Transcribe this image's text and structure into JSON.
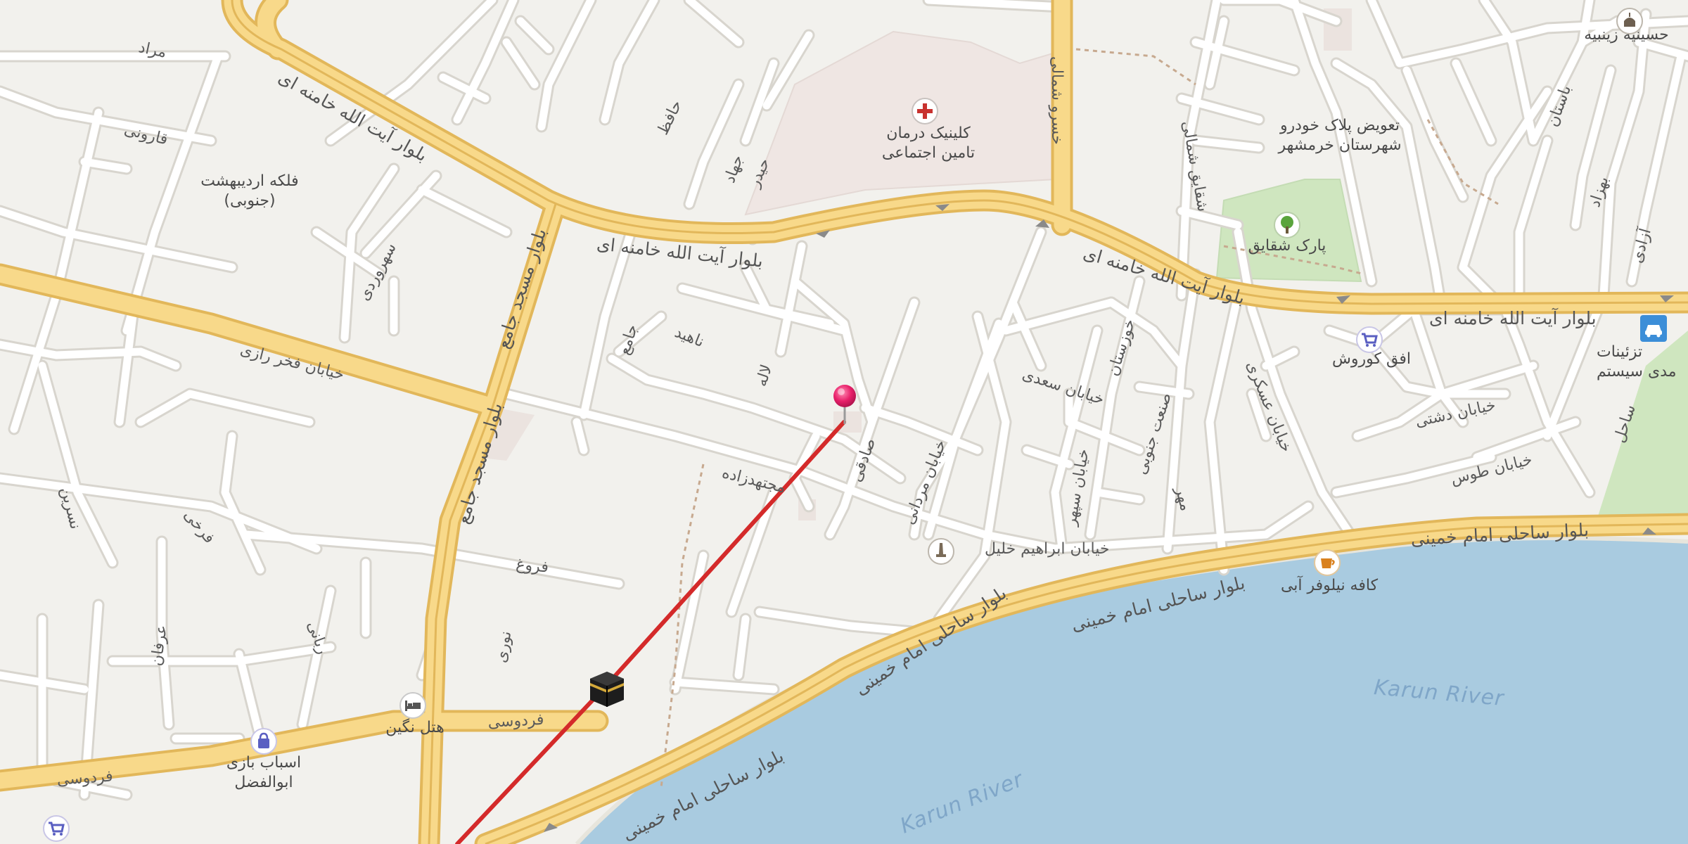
{
  "map": {
    "colors": {
      "land": "#f2f1ed",
      "water": "#a9cbe0",
      "major_road": "#f7d57d",
      "major_road_casing": "#e3b95a",
      "minor_road": "#ffffff",
      "minor_road_casing": "#d9d6cf",
      "park": "#cfe7bf",
      "hospital_area": "#efe7e4",
      "route": "#d42a2a",
      "pin": "#e8206a"
    },
    "labels": {
      "blvd_khamenei_1": "بلوار آیت الله خامنه ای",
      "blvd_khamenei_2": "بلوار آیت الله خامنه ای",
      "blvd_khamenei_3": "بلوار آیت الله خامنه ای",
      "blvd_khamenei_4": "بلوار آیت الله خامنه ای",
      "blvd_imam_1": "بلوار ساحلی امام خمینی",
      "blvd_imam_2": "بلوار ساحلی امام خمینی",
      "blvd_imam_3": "بلوار ساحلی امام خمینی",
      "blvd_imam_4": "بلوار ساحلی امام خمینی",
      "blvd_imam_5": "بلوار ساحلی امام خمینی",
      "blvd_masjed_1": "بلوار مسجد جامع",
      "blvd_masjed_2": "بلوار مسجد جامع",
      "blvd_masjed_3": "بلوار مسجد جامع",
      "fakhr_razi": "خیابان فخر رازی",
      "ferdowsi_1": "فردوسی",
      "ferdowsi_2": "فردوسی",
      "ebrahim_khalil": "خیابان ابراهیم خلیل",
      "sadi": "خیابان سعدی",
      "tous": "خیابان طوس",
      "dashti": "خیابان دشتی",
      "askari": "خیابان عسکری",
      "sepehr": "خیابان سپهر",
      "mardani": "خیابان مردانی",
      "khuzestan": "خوزستان",
      "sanat_jonoubi": "صنعت جنوبی",
      "shaghayegh_street": "شقایق شمالی",
      "dowlat_north": "خسرو شمالی",
      "mojtahedzadeh": "مجتهدزاده",
      "forough": "فروغ",
      "nahid": "ناهید",
      "lale": "لاله",
      "sadeghi": "صادقی",
      "jame": "جامع",
      "morad": "مراد",
      "karouni": "قارونی",
      "sohrevardi": "سهروردی",
      "jahad": "جهاد",
      "heidar": "حیدر",
      "nosrat": "نسرین",
      "farrokhi": "فرخی",
      "erfan": "عرفان",
      "rabani": "ربانی",
      "nouri": "نوری",
      "hafez": "حافظ",
      "bastan": "باستان",
      "behzad": "بهزاد",
      "azadi": "آزادی",
      "mehr": "مهر",
      "sahel": "ساحل",
      "karun_river_1": "Karun River",
      "karun_river_2": "Karun River"
    },
    "pois": {
      "clinic": "کلینیک درمان\nتامین اجتماعی",
      "plate_exchange": "تعویض پلاک خودرو\nشهرستان خرمشهر",
      "park_shaghayegh": "پارک شقایق",
      "ofogh_kourosh": "افق کوروش",
      "ordibehesht_square": "فلکه اردیبهشت\n(جنوبی)",
      "hotel_negin": "هتل نگین",
      "toys_abolfazl": "اسباب بازی\nابوالفضل",
      "cafe_nilofar": "کافه نیلوفر آبی",
      "hosseinieh": "حسینیه زینبیه",
      "service_center": "تزئینات\nمدی سیستم"
    },
    "icons": [
      "hospital-cross",
      "tree",
      "shopping-cart",
      "bed",
      "shopping-bag",
      "coffee-cup",
      "monument",
      "car",
      "mosque",
      "kaaba",
      "map-pin"
    ]
  }
}
